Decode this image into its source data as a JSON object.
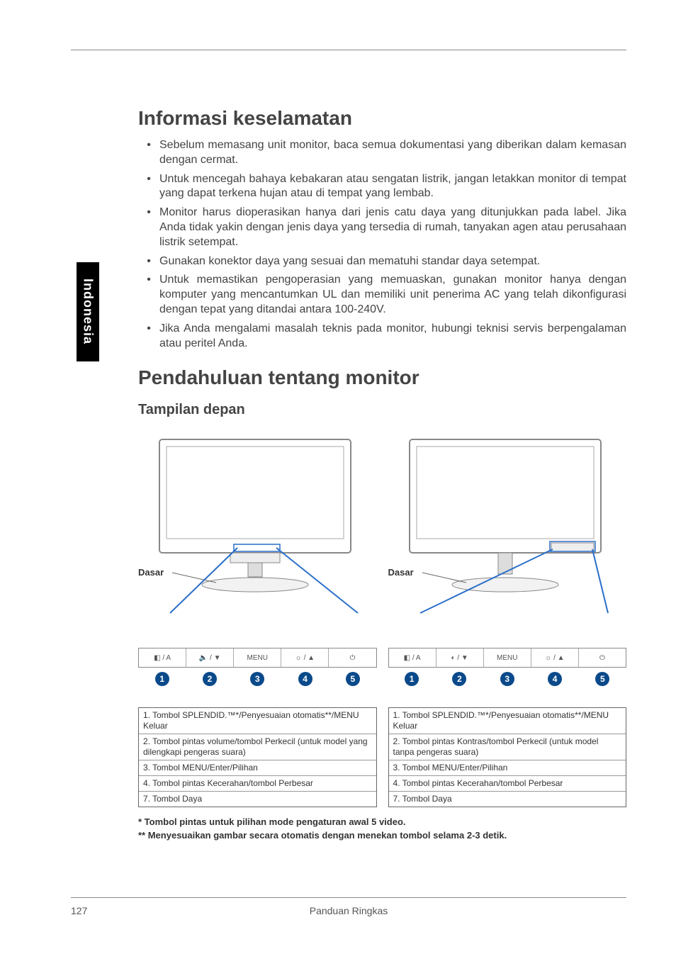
{
  "side_tab": "Indonesia",
  "h1_safety": "Informasi keselamatan",
  "safety_items": [
    "Sebelum memasang unit monitor, baca semua dokumentasi yang diberikan dalam kemasan dengan cermat.",
    "Untuk mencegah bahaya kebakaran atau sengatan listrik, jangan letakkan monitor di tempat yang dapat terkena hujan atau di tempat yang lembab.",
    "Monitor harus dioperasikan hanya dari jenis catu daya yang ditunjukkan pada label. Jika Anda tidak yakin dengan jenis daya yang tersedia di rumah, tanyakan agen atau perusahaan listrik setempat.",
    "Gunakan konektor daya yang sesuai dan mematuhi standar daya setempat.",
    "Untuk memastikan pengoperasian yang memuaskan, gunakan monitor hanya dengan komputer yang mencantumkan UL dan memiliki unit penerima AC yang telah dikonfigurasi dengan tepat yang ditandai antara 100-240V.",
    "Jika Anda mengalami masalah teknis pada monitor, hubungi teknisi servis berpengalaman atau peritel Anda."
  ],
  "h1_intro": "Pendahuluan tentang monitor",
  "h2_front": "Tampilan depan",
  "dasar_label": "Dasar",
  "button_labels_left": {
    "b1": "◧ / A",
    "b2": "🔈 / ▼",
    "b3": "MENU",
    "b4": "☼ / ▲",
    "b5": "⏻"
  },
  "button_labels_right": {
    "b1": "◧ / A",
    "b2": "◐ / ▼",
    "b3": "MENU",
    "b4": "☼ / ▲",
    "b5": "⏻"
  },
  "numbers": [
    "1",
    "2",
    "3",
    "4",
    "5"
  ],
  "legend_left": [
    "1.  Tombol SPLENDID.™*/Penyesuaian otomatis**/MENU Keluar",
    "2. Tombol pintas volume/tombol Perkecil (untuk model yang dilengkapi pengeras suara)",
    "3. Tombol MENU/Enter/Pilihan",
    "4. Tombol pintas Kecerahan/tombol Perbesar",
    "7. Tombol Daya"
  ],
  "legend_right": [
    "1.  Tombol SPLENDID.™*/Penyesuaian otomatis**/MENU Keluar",
    "2. Tombol pintas Kontras/tombol Perkecil (untuk model tanpa pengeras suara)",
    "3. Tombol MENU/Enter/Pilihan",
    "4. Tombol pintas Kecerahan/tombol Perbesar",
    "7. Tombol Daya"
  ],
  "footnote1": "*   Tombol pintas untuk pilihan mode pengaturan awal 5 video.",
  "footnote2": "**  Menyesuaikan gambar secara otomatis dengan menekan tombol selama 2-3 detik.",
  "page_number": "127",
  "footer_title": "Panduan Ringkas"
}
